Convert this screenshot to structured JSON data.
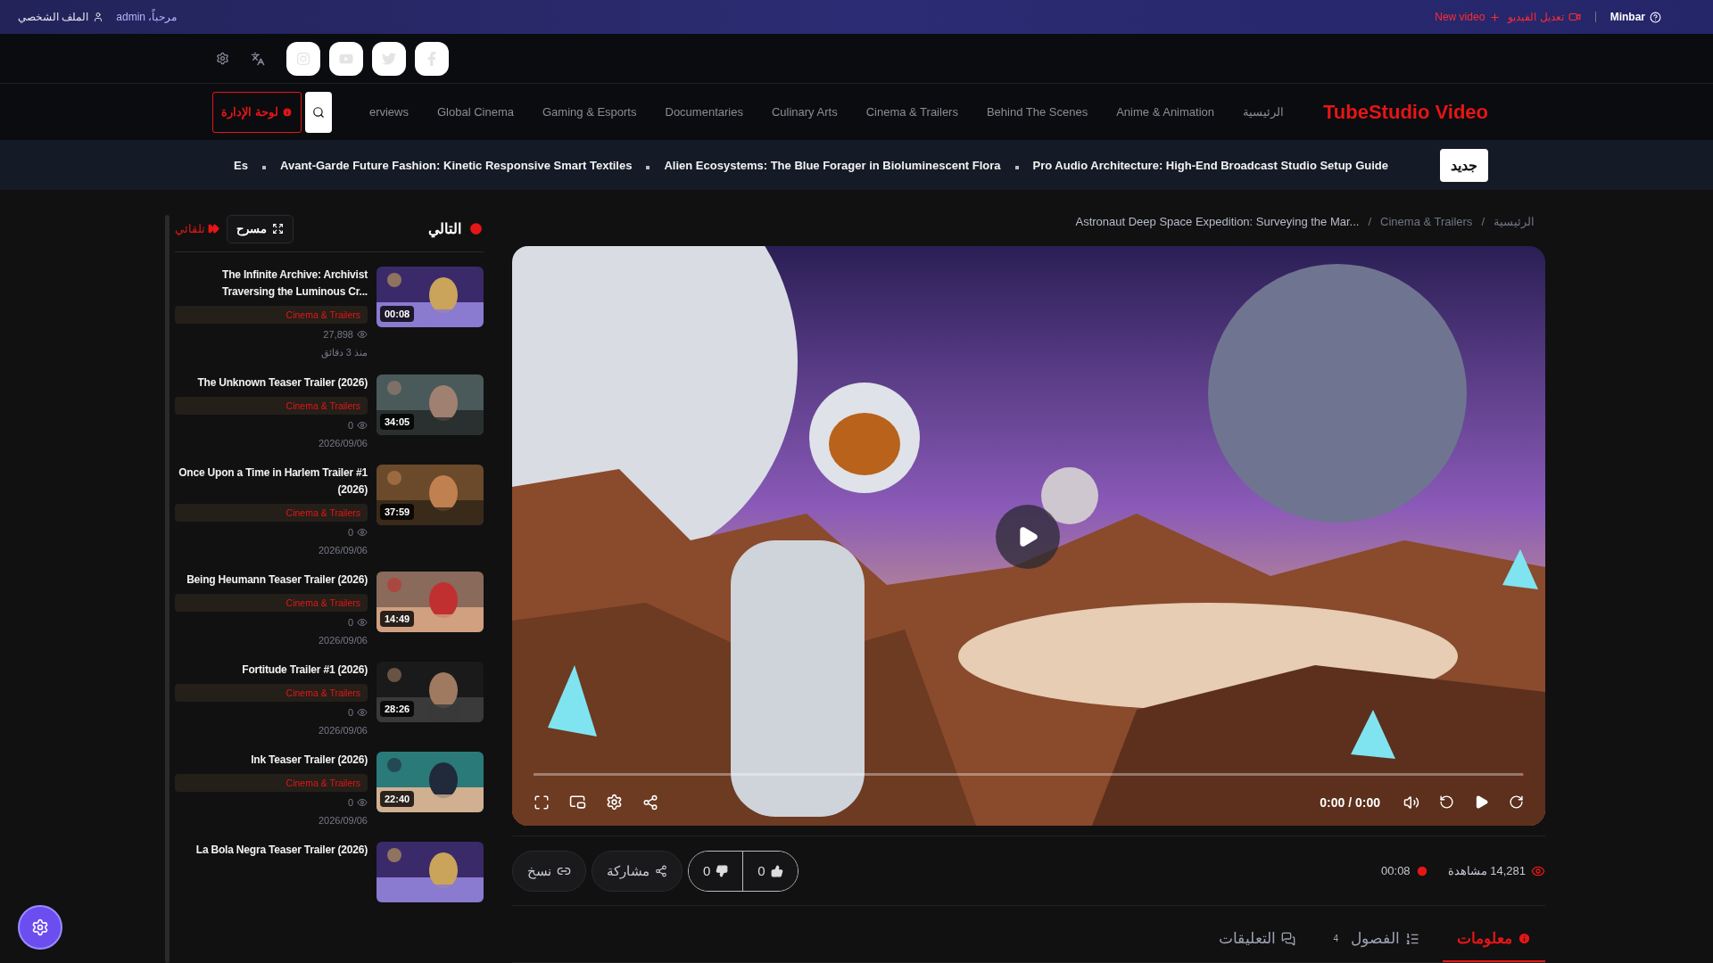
{
  "top_bar": {
    "site": "Minbar",
    "edit_video": "تعديل الفيديو",
    "new_video": "New video",
    "greeting": "مرحباً، admin",
    "profile": "الملف الشخصي"
  },
  "header": {
    "logo": "TubeStudio Video",
    "nav": [
      {
        "label": "erviews",
        "selected": false
      },
      {
        "label": "Global Cinema",
        "selected": false
      },
      {
        "label": "Gaming & Esports",
        "selected": false
      },
      {
        "label": "Documentaries",
        "selected": false
      },
      {
        "label": "Culinary Arts",
        "selected": false
      },
      {
        "label": "Cinema & Trailers",
        "selected": false
      },
      {
        "label": "Behind The Scenes",
        "selected": false
      },
      {
        "label": "Anime & Animation",
        "selected": false
      },
      {
        "label": "الرئيسية",
        "selected": false
      }
    ],
    "admin_button": "لوحة الإدارة"
  },
  "ticker": {
    "badge": "جديد",
    "items": [
      "Es",
      "Avant-Garde Future Fashion: Kinetic Responsive Smart Textiles",
      "Alien Ecosystems: The Blue Forager in Bioluminescent Flora",
      "Pro Audio Architecture: High-End Broadcast Studio Setup Guide"
    ]
  },
  "breadcrumb": {
    "items": [
      "Astronaut Deep Space Expedition: Surveying the Mar...",
      "Cinema & Trailers",
      "الرئيسية"
    ],
    "separators": [
      "/",
      "/"
    ]
  },
  "player": {
    "time": "0:00 / 0:00",
    "level": 0
  },
  "stats": {
    "views": "14,281 مشاهدة",
    "duration": "00:08"
  },
  "actions": {
    "likes": "0",
    "dislikes": "0",
    "share": "مشاركة",
    "copy": "نسخ"
  },
  "tabs": [
    {
      "label": "معلومات",
      "selected": true
    },
    {
      "label": "الفصول",
      "count": "4",
      "selected": false
    },
    {
      "label": "التعليقات",
      "selected": false
    }
  ],
  "sidebar": {
    "heading": "التالي",
    "theater": "مسرح",
    "autoplay": {
      "label": "تلقائي",
      "on": true
    },
    "videos": [
      {
        "title": "The Infinite Archive: Archivist Traversing the Luminous Cr...",
        "category": "Cinema & Trailers",
        "views": "27,898",
        "date": "منذ 3 دقائق",
        "duration": "00:08"
      },
      {
        "title": "The Unknown Teaser Trailer (2026)",
        "category": "Cinema & Trailers",
        "views": "0",
        "date": "2026/09/06",
        "duration": "34:05"
      },
      {
        "title": "Once Upon a Time in Harlem Trailer #1 (2026)",
        "category": "Cinema & Trailers",
        "views": "0",
        "date": "2026/09/06",
        "duration": "37:59"
      },
      {
        "title": "Being Heumann Teaser Trailer (2026)",
        "category": "Cinema & Trailers",
        "views": "0",
        "date": "2026/09/06",
        "duration": "14:49"
      },
      {
        "title": "Fortitude Trailer #1 (2026)",
        "category": "Cinema & Trailers",
        "views": "0",
        "date": "2026/09/06",
        "duration": "28:26"
      },
      {
        "title": "Ink Teaser Trailer (2026)",
        "category": "Cinema & Trailers",
        "views": "0",
        "date": "2026/09/06",
        "duration": "22:40"
      },
      {
        "title": "La Bola Negra Teaser Trailer (2026)"
      }
    ]
  }
}
